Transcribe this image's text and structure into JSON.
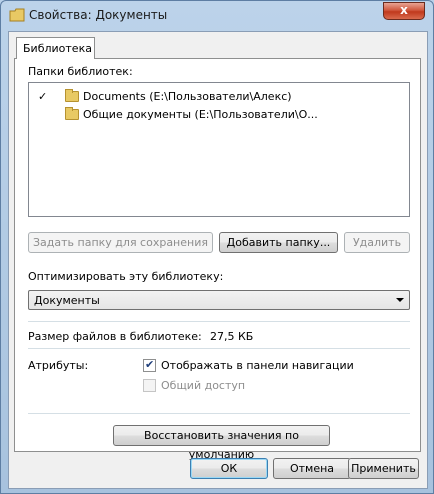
{
  "window": {
    "title": "Свойства: Документы",
    "close_glyph": "x"
  },
  "tabs": [
    {
      "label": "Библиотека"
    }
  ],
  "library": {
    "folders_label": "Папки библиотек:",
    "folders": [
      {
        "check": "✓",
        "text": "Documents (E:\\Пользователи\\Алекс)"
      },
      {
        "check": "",
        "text": "Общие документы (E:\\Пользователи\\О..."
      }
    ],
    "set_save_folder": "Задать папку для сохранения",
    "add_folder": "Добавить папку...",
    "remove": "Удалить",
    "optimize_label": "Оптимизировать эту библиотеку:",
    "optimize_value": "Документы",
    "size_label": "Размер файлов в библиотеке:",
    "size_value": "27,5 КБ",
    "attributes_label": "Атрибуты:",
    "show_in_nav": "Отображать в панели навигации",
    "shared": "Общий доступ",
    "restore_defaults": "Восстановить значения по умолчанию"
  },
  "footer": {
    "ok": "ОК",
    "cancel": "Отмена",
    "apply": "Применить"
  }
}
